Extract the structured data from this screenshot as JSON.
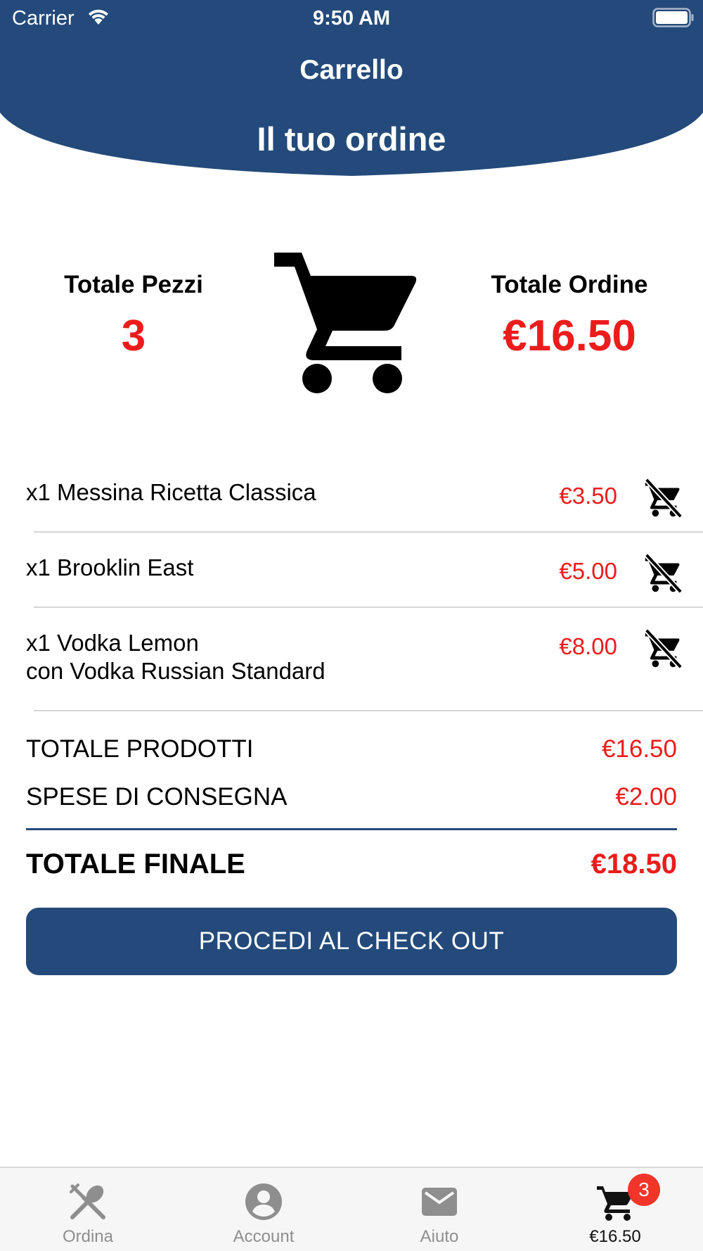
{
  "status_bar": {
    "carrier": "Carrier",
    "time": "9:50 AM"
  },
  "header": {
    "nav_title": "Carrello",
    "subtitle": "Il tuo ordine",
    "color": "#234a7a"
  },
  "summary": {
    "pieces_label": "Totale Pezzi",
    "pieces_value": "3",
    "order_label": "Totale Ordine",
    "order_value": "€16.50",
    "icon": "shopping-cart-icon"
  },
  "items": [
    {
      "name": "x1 Messina Ricetta Classica",
      "detail": "",
      "price": "€3.50",
      "remove_icon": "remove-from-cart-icon"
    },
    {
      "name": "x1 Brooklin East",
      "detail": "",
      "price": "€5.00",
      "remove_icon": "remove-from-cart-icon"
    },
    {
      "name": "x1 Vodka Lemon",
      "detail": "con Vodka Russian Standard",
      "price": "€8.00",
      "remove_icon": "remove-from-cart-icon"
    }
  ],
  "totals": {
    "products_label": "TOTALE PRODOTTI",
    "products_value": "€16.50",
    "delivery_label": "SPESE DI CONSEGNA",
    "delivery_value": "€2.00",
    "final_label": "TOTALE FINALE",
    "final_value": "€18.50"
  },
  "checkout_label": "PROCEDI AL CHECK OUT",
  "tab_bar": {
    "tabs": [
      {
        "label": "Ordina",
        "icon": "fork-knife-icon"
      },
      {
        "label": "Account",
        "icon": "account-icon"
      },
      {
        "label": "Aiuto",
        "icon": "mail-icon"
      },
      {
        "label": "€16.50",
        "icon": "cart-icon",
        "badge": "3",
        "active": true
      }
    ]
  },
  "colors": {
    "accent": "#234a7a",
    "price": "#ec1c1c",
    "badge": "#f1352b"
  }
}
